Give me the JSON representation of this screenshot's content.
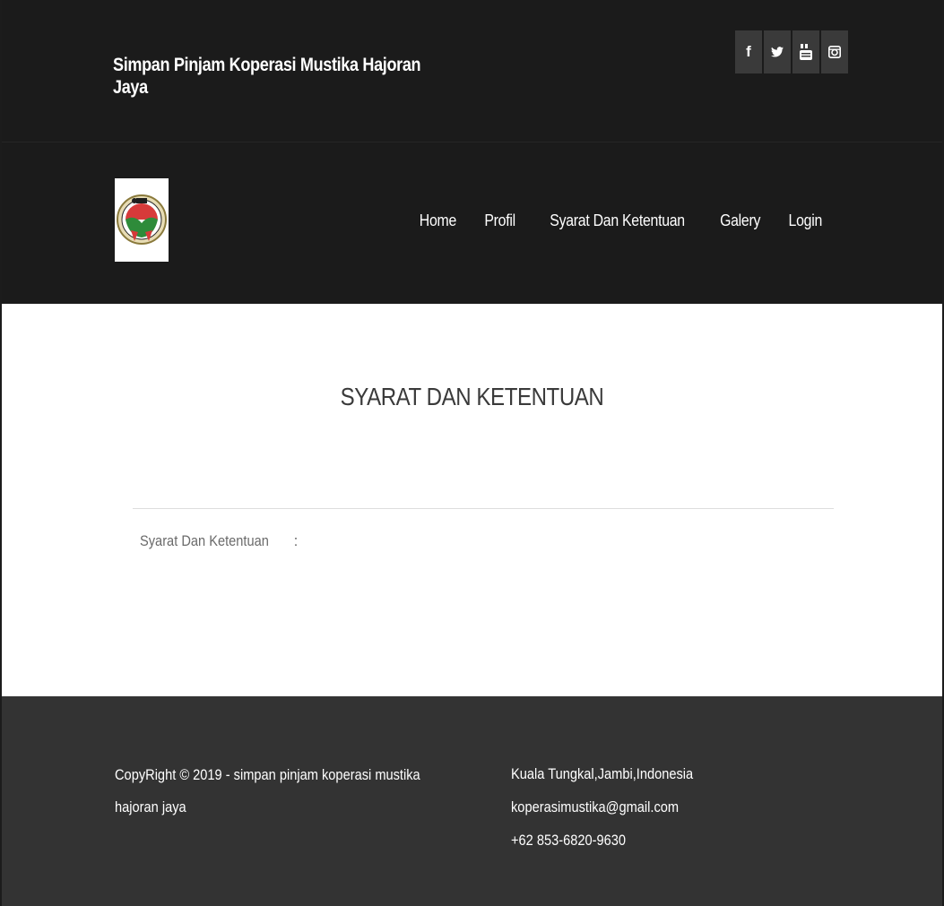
{
  "header": {
    "site_title": "Simpan Pinjam Koperasi Mustika Hajoran Jaya",
    "social": [
      {
        "label": "f",
        "icon": "facebook-icon"
      },
      {
        "label": "",
        "icon": "twitter-icon"
      },
      {
        "label": "",
        "icon": "youtube-icon"
      },
      {
        "label": "",
        "icon": "instagram-icon"
      }
    ]
  },
  "nav": {
    "logo_icon": "cooperative-logo",
    "items": [
      {
        "label": "Home"
      },
      {
        "label": "Profil"
      },
      {
        "label": "Syarat Dan Ketentuan"
      },
      {
        "label": "Galery"
      },
      {
        "label": "Login"
      }
    ]
  },
  "main": {
    "title": "SYARAT DAN KETENTUAN",
    "field_label": "Syarat Dan Ketentuan",
    "field_separator": ":",
    "field_value": ""
  },
  "footer": {
    "copyright": "CopyRight © 2019 - simpan pinjam koperasi mustika hajoran jaya",
    "address": "Kuala Tungkal,Jambi,Indonesia",
    "email": "koperasimustika@gmail.com",
    "phone": "+62 853-6820-9630"
  },
  "colors": {
    "header_bg": "#1b1b1b",
    "footer_bg": "#333333",
    "social_btn_bg": "#3a3a3a"
  }
}
